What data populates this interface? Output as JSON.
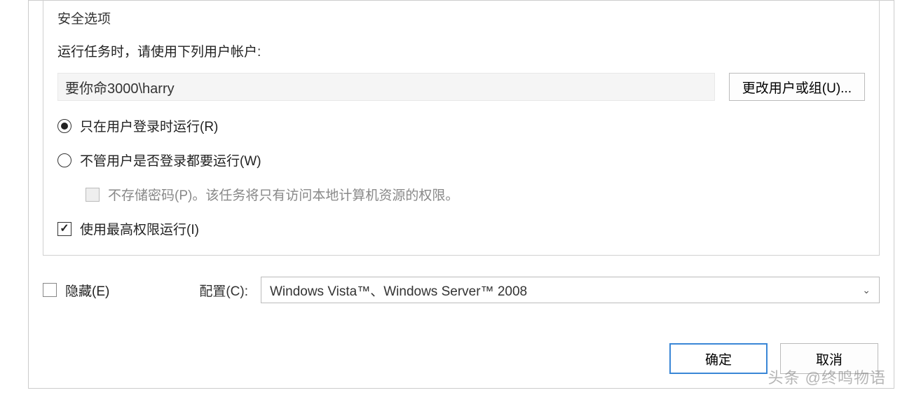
{
  "group": {
    "title": "安全选项",
    "run_as_label": "运行任务时，请使用下列用户帐户:",
    "user_account": "要你命3000\\harry",
    "change_user_btn": "更改用户或组(U)...",
    "radio_logged_on": "只在用户登录时运行(R)",
    "radio_any_time": "不管用户是否登录都要运行(W)",
    "no_store_pwd": "不存储密码(P)。该任务将只有访问本地计算机资源的权限。",
    "highest_priv": "使用最高权限运行(I)"
  },
  "bottom": {
    "hidden_label": "隐藏(E)",
    "config_label": "配置(C):",
    "config_value": "Windows Vista™、Windows Server™ 2008"
  },
  "buttons": {
    "ok": "确定",
    "cancel": "取消"
  },
  "watermark": "头条 @终鸣物语"
}
